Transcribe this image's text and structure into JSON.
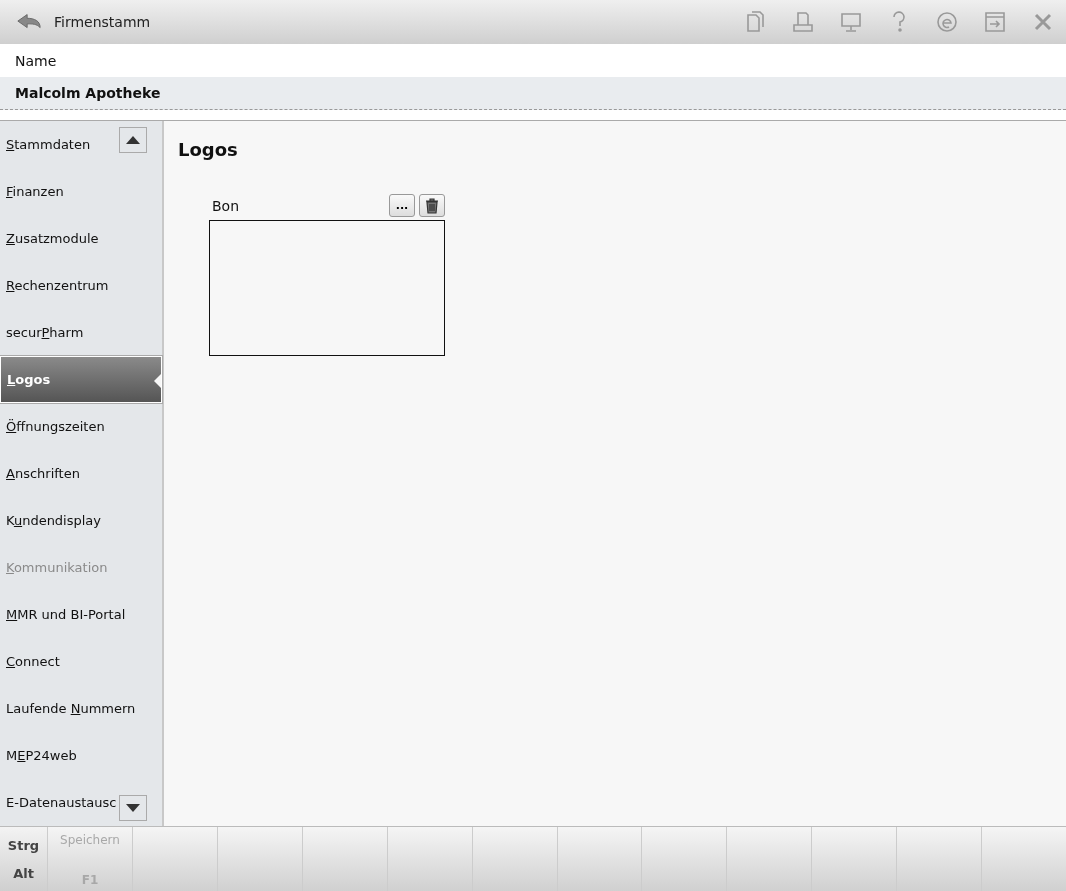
{
  "window": {
    "title": "Firmenstamm"
  },
  "header": {
    "label": "Name",
    "value": "Malcolm Apotheke"
  },
  "sidebar": {
    "items": [
      {
        "key": "S",
        "after": "tammdaten",
        "selected": false,
        "disabled": false
      },
      {
        "key": "F",
        "after": "inanzen",
        "selected": false,
        "disabled": false
      },
      {
        "key": "Z",
        "after": "usatzmodule",
        "selected": false,
        "disabled": false
      },
      {
        "key": "R",
        "after": "echenzentrum",
        "selected": false,
        "disabled": false
      },
      {
        "before": "secur",
        "key": "P",
        "after": "harm",
        "selected": false,
        "disabled": false
      },
      {
        "key": "L",
        "after": "ogos",
        "selected": true,
        "disabled": false
      },
      {
        "key": "Ö",
        "after": "ffnungszeiten",
        "selected": false,
        "disabled": false
      },
      {
        "key": "A",
        "after": "nschriften",
        "selected": false,
        "disabled": false
      },
      {
        "before": "K",
        "key": "u",
        "after": "ndendisplay",
        "selected": false,
        "disabled": false
      },
      {
        "key": "K",
        "after": "ommunikation",
        "selected": false,
        "disabled": true
      },
      {
        "key": "M",
        "after": "MR und BI-Portal",
        "selected": false,
        "disabled": false
      },
      {
        "key": "C",
        "after": "onnect",
        "selected": false,
        "disabled": false
      },
      {
        "before": "Laufende ",
        "key": "N",
        "after": "ummern",
        "selected": false,
        "disabled": false
      },
      {
        "before": "M",
        "key": "E",
        "after": "P24web",
        "selected": false,
        "disabled": false
      },
      {
        "before": "E-Datenaustausc",
        "selected": false,
        "disabled": false
      }
    ]
  },
  "content": {
    "title": "Logos",
    "logo_slots": [
      {
        "label": "Bon",
        "browse_button": "..."
      }
    ]
  },
  "footer": {
    "modifiers": [
      "Strg",
      "Alt"
    ],
    "keys": [
      {
        "label": "Speichern",
        "key": "F1",
        "disabled": true
      }
    ]
  }
}
